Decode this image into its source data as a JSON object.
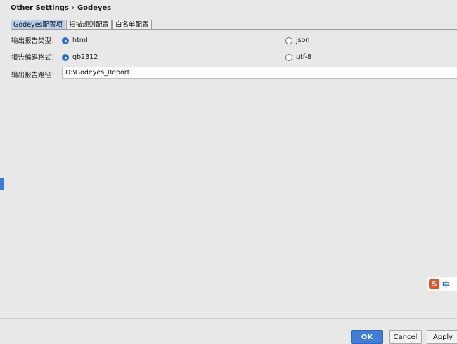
{
  "breadcrumb": {
    "parent": "Other Settings",
    "separator": "›",
    "current": "Godeyes"
  },
  "tabs": [
    {
      "label": "Godeyes配置项",
      "active": true
    },
    {
      "label": "扫描规则配置",
      "active": false
    },
    {
      "label": "白名单配置",
      "active": false
    }
  ],
  "form": {
    "report_type": {
      "label": "输出报告类型：",
      "options": [
        {
          "label": "html",
          "selected": true
        },
        {
          "label": "json",
          "selected": false
        }
      ]
    },
    "encoding": {
      "label": "报告编码格式：",
      "options": [
        {
          "label": "gb2312",
          "selected": true
        },
        {
          "label": "utf-8",
          "selected": false
        }
      ]
    },
    "report_path": {
      "label": "输出报告路径：",
      "value": "D:\\Godeyes_Report"
    }
  },
  "ime": {
    "logo": "S",
    "mode": "中"
  },
  "buttons": {
    "ok": "OK",
    "cancel": "Cancel",
    "apply": "Apply"
  },
  "colors": {
    "accent": "#3e7ed6",
    "active_tab": "#b7cfee",
    "ime_logo": "#e8502a"
  }
}
